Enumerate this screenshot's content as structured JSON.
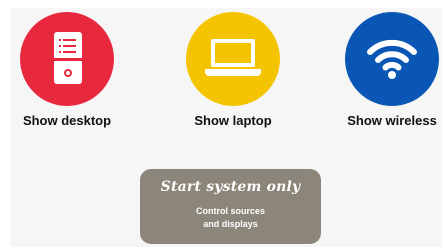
{
  "sources": [
    {
      "label": "Show desktop",
      "icon": "desktop-tower-icon",
      "color": "#e8283c"
    },
    {
      "label": "Show laptop",
      "icon": "laptop-icon",
      "color": "#f5c400"
    },
    {
      "label": "Show wireless",
      "icon": "wifi-icon",
      "color": "#0a56b5"
    }
  ],
  "start_card": {
    "title": "Start system only",
    "description_line1": "Control sources",
    "description_line2": "and displays",
    "color": "#8c8579"
  }
}
